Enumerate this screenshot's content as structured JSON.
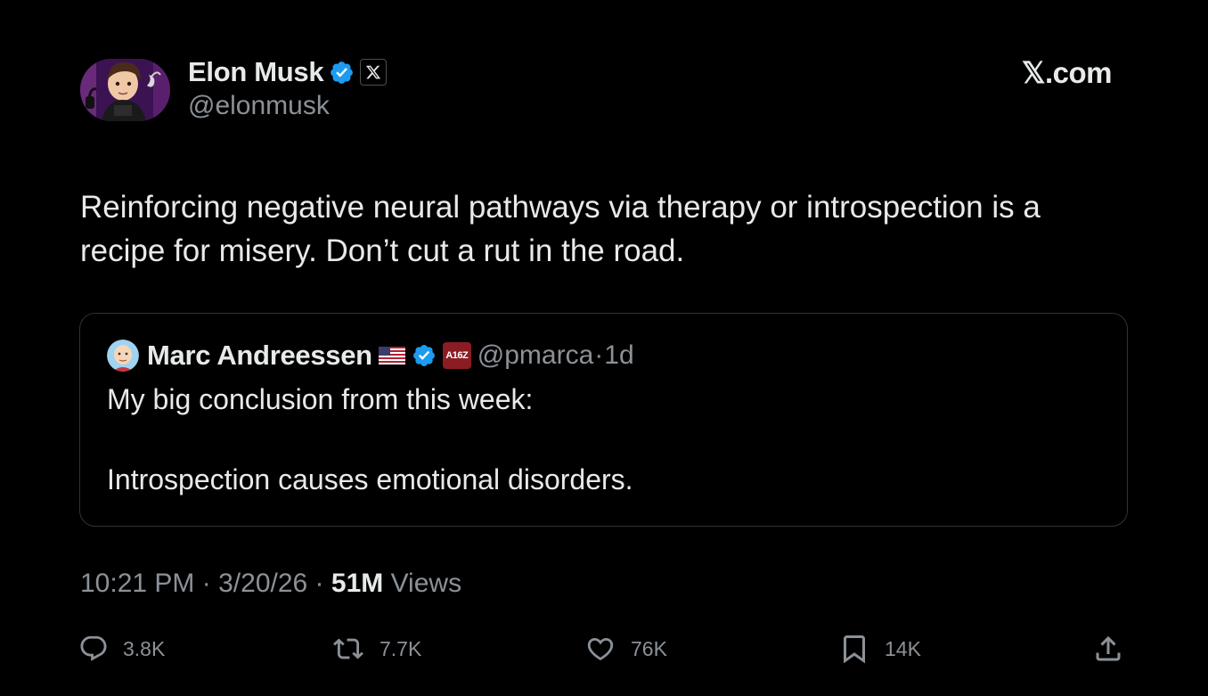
{
  "author": {
    "name": "Elon Musk",
    "handle": "@elonmusk",
    "verified": true,
    "affiliate_icon": "x-logo-icon"
  },
  "brand": "𝕏.com",
  "tweet": {
    "text": "Reinforcing negative neural pathways via therapy or introspection is a recipe for misery. Don’t cut a rut in the road."
  },
  "quote": {
    "name": "Marc Andreessen",
    "flag_icon": "us-flag-icon",
    "badge": "A16Z",
    "handle": "@pmarca",
    "separator": "·",
    "time": "1d",
    "lines": [
      "My big conclusion from this week:",
      "Introspection causes emotional disorders."
    ]
  },
  "meta": {
    "time": "10:21 PM",
    "date": "3/20/26",
    "views_count": "51M",
    "views_label": "Views",
    "separator": "·"
  },
  "actions": {
    "replies": "3.8K",
    "reposts": "7.7K",
    "likes": "76K",
    "bookmarks": "14K"
  },
  "colors": {
    "background": "#000000",
    "text": "#e7e9ea",
    "muted": "#8b9197",
    "verified_blue": "#1d9bf0",
    "border": "#2f3336"
  }
}
